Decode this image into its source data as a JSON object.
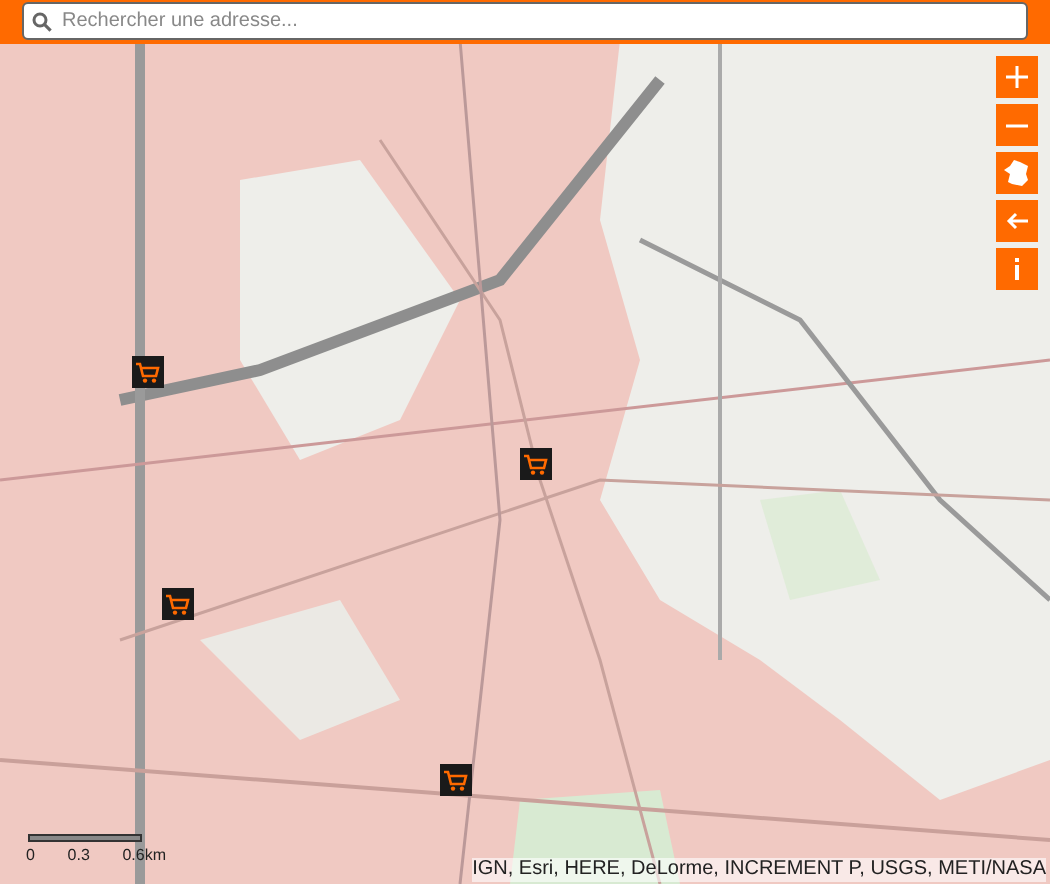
{
  "search": {
    "placeholder": "Rechercher une adresse..."
  },
  "scale": {
    "labels": [
      "0",
      "0.3",
      "0.6km"
    ]
  },
  "attribution": "IGN, Esri, HERE, DeLorme, INCREMENT P, USGS, METI/NASA"
}
